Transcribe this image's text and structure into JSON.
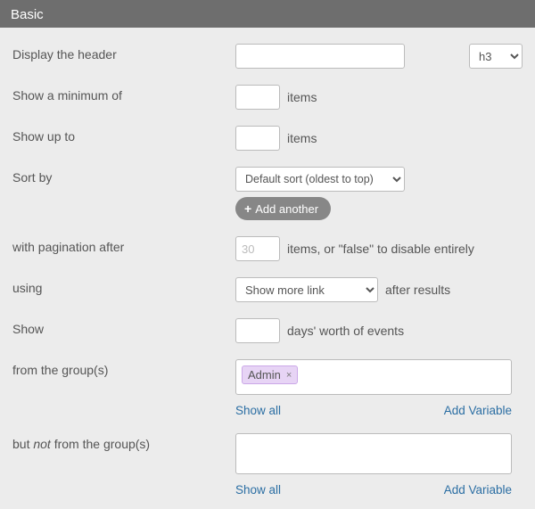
{
  "panel_title": "Basic",
  "labels": {
    "header": "Display the header",
    "min": "Show a minimum of",
    "max": "Show up to",
    "sort": "Sort by",
    "pagination": "with pagination after",
    "using": "using",
    "show_days": "Show",
    "from_groups_a": "from the group(s)",
    "not_groups_a": "but ",
    "not_groups_b": "not",
    "not_groups_c": " from the group(s)"
  },
  "after": {
    "items": "items",
    "pagination": "items, or \"false\" to disable entirely",
    "using": "after results",
    "days": "days' worth of events"
  },
  "inputs": {
    "header_value": "",
    "min_value": "",
    "max_value": "",
    "pagination_placeholder": "30",
    "pagination_value": "",
    "days_value": ""
  },
  "selects": {
    "heading_level": "h3",
    "sort_option": "Default sort (oldest to top)",
    "pager_option": "Show more link"
  },
  "buttons": {
    "add_another": "Add another"
  },
  "group_box": {
    "tokens": [
      "Admin"
    ],
    "show_all": "Show all",
    "add_variable": "Add Variable"
  },
  "exclude_box": {
    "show_all": "Show all",
    "add_variable": "Add Variable"
  }
}
